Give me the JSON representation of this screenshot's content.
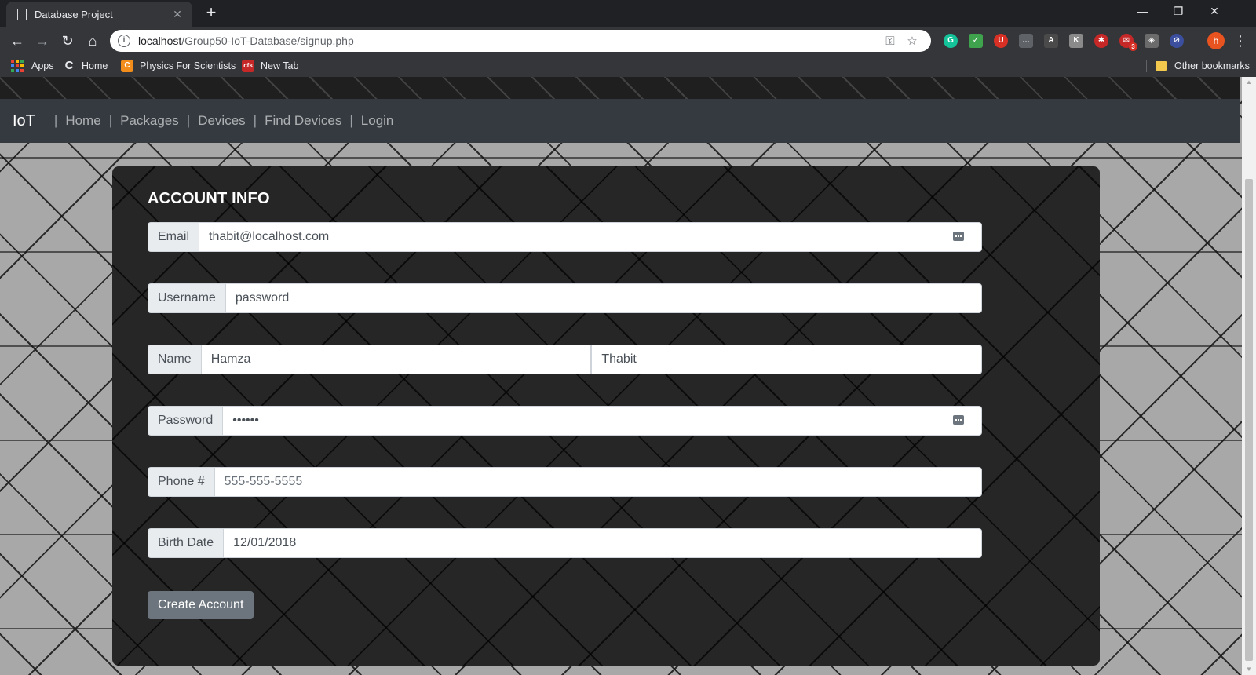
{
  "browser": {
    "tab_title": "Database Project",
    "tab_close": "✕",
    "new_tab": "+",
    "window": {
      "minimize": "—",
      "restore": "❐",
      "close": "✕"
    },
    "url_host": "localhost",
    "url_path": "/Group50-IoT-Database/signup.php",
    "profile_initial": "h",
    "extension_badge": "3",
    "bookmarks": [
      {
        "label": "Apps"
      },
      {
        "label": "Home"
      },
      {
        "label": "Physics For Scientists"
      },
      {
        "label": "New Tab"
      }
    ],
    "other_bookmarks": "Other bookmarks"
  },
  "navbar": {
    "brand": "IoT",
    "links": [
      "Home",
      "Packages",
      "Devices",
      "Find Devices",
      "Login"
    ],
    "separator": "|"
  },
  "form": {
    "title": "ACCOUNT INFO",
    "email": {
      "label": "Email",
      "value": "thabit@localhost.com"
    },
    "username": {
      "label": "Username",
      "value": "password"
    },
    "name": {
      "label": "Name",
      "first": "Hamza",
      "last": "Thabit"
    },
    "password": {
      "label": "Password",
      "value": "••••••"
    },
    "phone": {
      "label": "Phone #",
      "placeholder": "555-555-5555"
    },
    "birth_date": {
      "label": "Birth Date",
      "value": "12/01/2018"
    },
    "submit_label": "Create Account"
  },
  "colors": {
    "navbar_bg": "#343a40",
    "card_bg": "#262626",
    "button_bg": "#6c757d",
    "addon_bg": "#e9ecef"
  }
}
